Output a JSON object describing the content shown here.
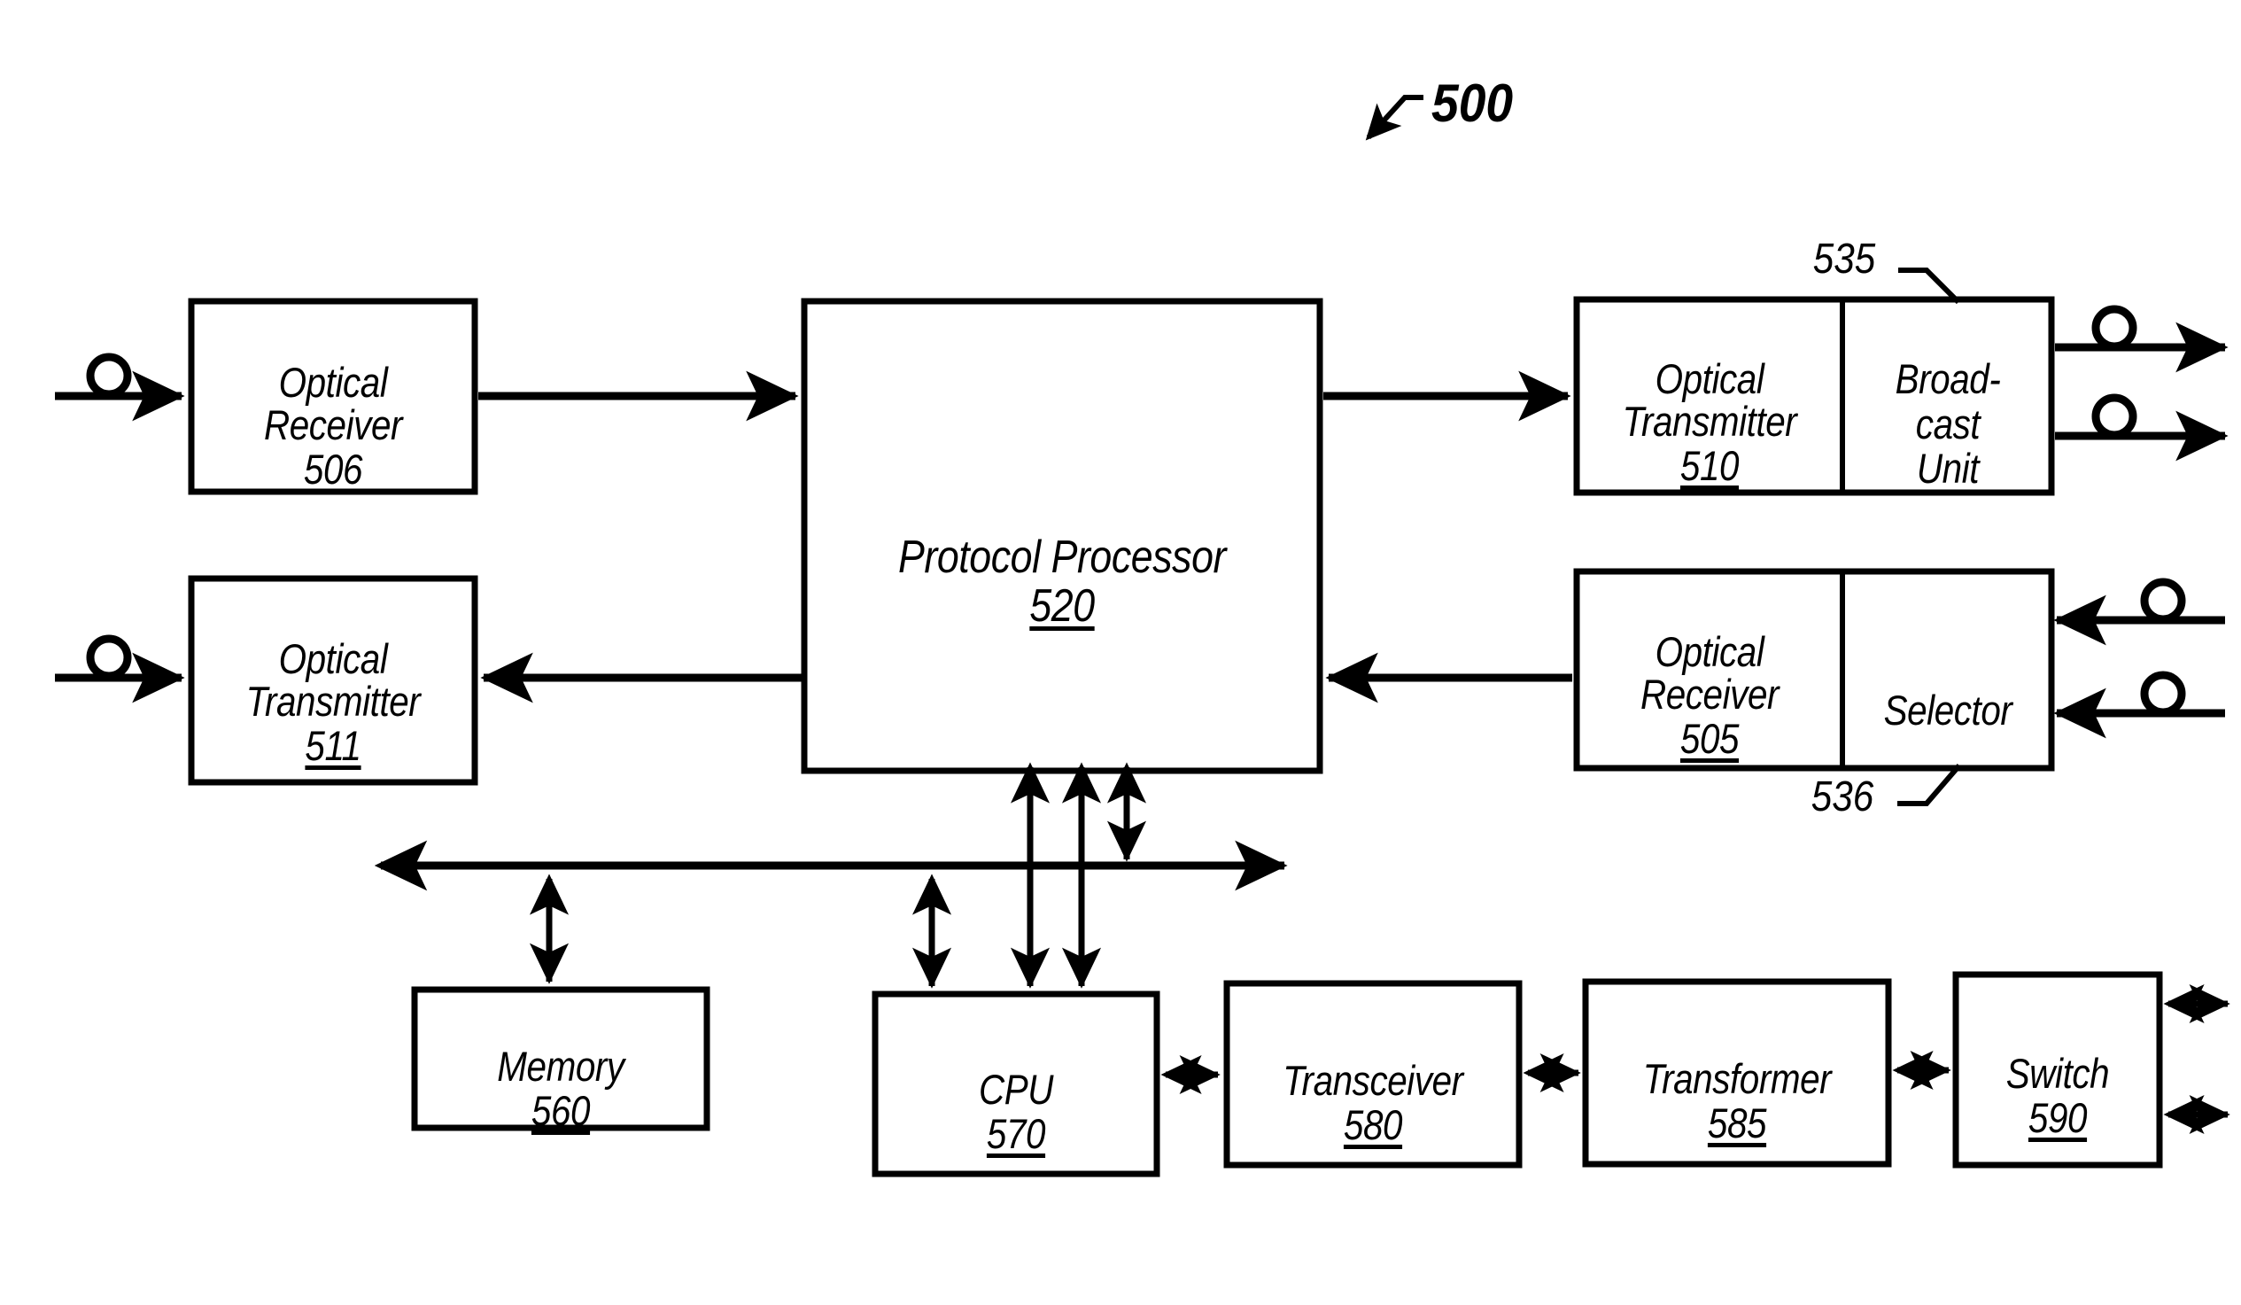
{
  "figure": {
    "number": "500",
    "title_ref": "500"
  },
  "callouts": {
    "broadcast_unit_ref": "535",
    "selector_ref": "536"
  },
  "blocks": {
    "optical_receiver_506": {
      "name": "Optical\nReceiver",
      "ref": "506"
    },
    "optical_transmitter_511": {
      "name": "Optical\nTransmitter",
      "ref": "511"
    },
    "protocol_processor_520": {
      "name": "Protocol Processor",
      "ref": "520"
    },
    "optical_transmitter_510": {
      "name": "Optical\nTransmitter",
      "ref": "510"
    },
    "broadcast_unit": {
      "name": "Broad-\ncast\nUnit",
      "ref": ""
    },
    "optical_receiver_505": {
      "name": "Optical\nReceiver",
      "ref": "505"
    },
    "selector": {
      "name": "Selector",
      "ref": ""
    },
    "memory_560": {
      "name": "Memory",
      "ref": "560"
    },
    "cpu_570": {
      "name": "CPU",
      "ref": "570"
    },
    "transceiver_580": {
      "name": "Transceiver",
      "ref": "580"
    },
    "transformer_585": {
      "name": "Transformer",
      "ref": "585"
    },
    "switch_590": {
      "name": "Switch",
      "ref": "590"
    }
  },
  "colors": {
    "line": "#000000",
    "background": "#ffffff",
    "text": "#000000"
  }
}
